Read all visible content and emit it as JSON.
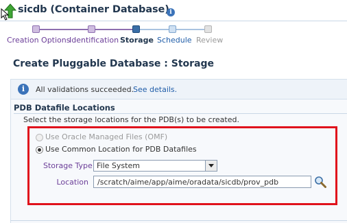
{
  "header": {
    "title": "sicdb (Container Database)",
    "info_icon": "i"
  },
  "train": {
    "steps": [
      {
        "label": "Creation Options",
        "state": "visited"
      },
      {
        "label": "Identification",
        "state": "visited"
      },
      {
        "label": "Storage",
        "state": "current"
      },
      {
        "label": "Schedule",
        "state": "future"
      },
      {
        "label": "Review",
        "state": "disabled"
      }
    ]
  },
  "page": {
    "title": "Create Pluggable Database : Storage"
  },
  "info": {
    "icon": "i",
    "message": "All validations succeeded.",
    "link": "See details."
  },
  "section": {
    "title": "PDB Datafile Locations",
    "instructions": "Select the storage locations for the PDB(s) to be created.",
    "omf_label": "Use Oracle Managed Files (OMF)",
    "common_label": "Use Common Location for PDB Datafiles",
    "storage_type_label": "Storage Type",
    "storage_type_value": "File System",
    "location_label": "Location",
    "location_value": "/scratch/aime/app/aime/oradata/sicdb/prov_pdb"
  },
  "colors": {
    "accent": "#22374f",
    "highlight": "#e0121c",
    "link": "#1f5ca8",
    "visited": "#6b3e98"
  }
}
